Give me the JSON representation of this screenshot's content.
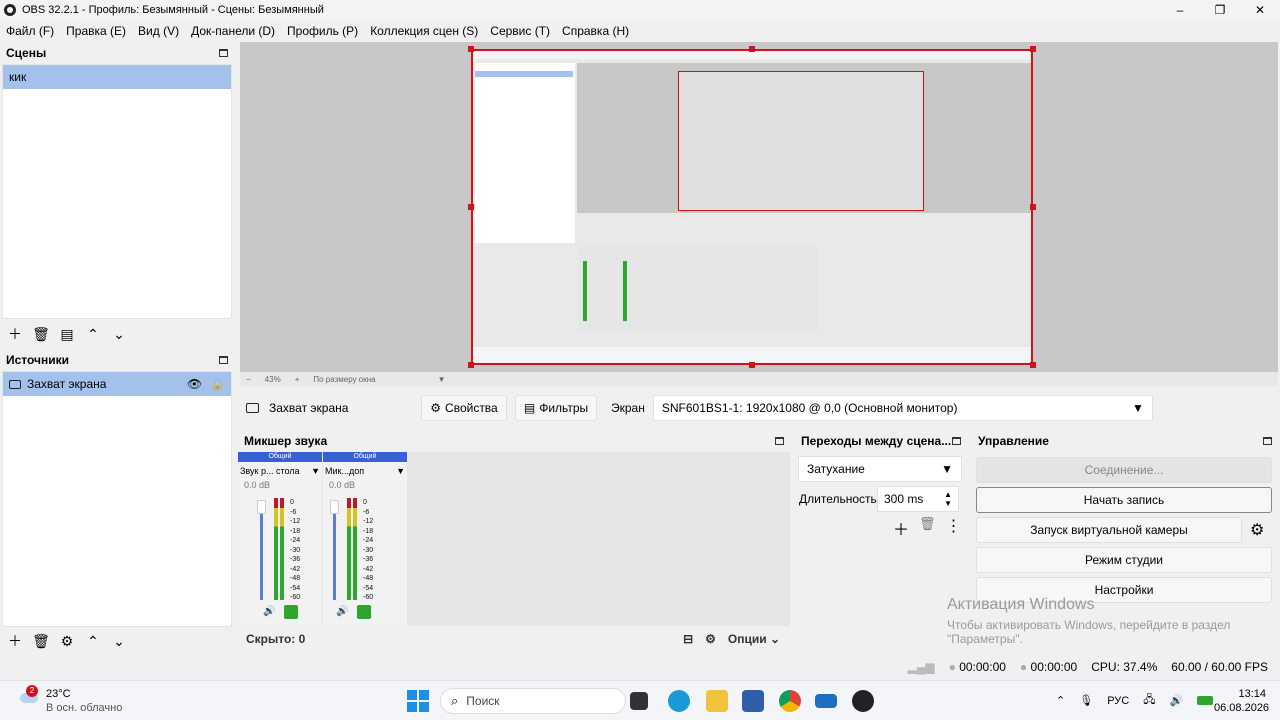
{
  "window": {
    "title": "OBS 32.2.1 - Профиль: Безымянный - Сцены: Безымянный",
    "minimize": "–",
    "maximize": "❐",
    "close": "✕"
  },
  "menu": [
    "Файл (F)",
    "Правка (E)",
    "Вид (V)",
    "Док-панели (D)",
    "Профиль (P)",
    "Коллекция сцен (S)",
    "Сервис (T)",
    "Справка (H)"
  ],
  "scenes": {
    "title": "Сцены",
    "items": [
      "кик"
    ]
  },
  "sources": {
    "title": "Источники",
    "items": [
      "Захват экрана"
    ]
  },
  "preview": {
    "zoom": "43%",
    "zoom_minus": "−",
    "zoom_plus": "+",
    "fit": "По размеру окна"
  },
  "source_bar": {
    "name": "Захват экрана",
    "properties": "Свойства",
    "filters": "Фильтры",
    "screen_label": "Экран",
    "screen_value": "SNF601BS1-1: 1920x1080 @ 0,0 (Основной монитор)"
  },
  "mixer": {
    "title": "Микшер звука",
    "channels": [
      {
        "tag": "Общий",
        "name": "Звук р... стола",
        "db": "0.0 dB"
      },
      {
        "tag": "Общий",
        "name": "Мик...доп",
        "db": "0.0 dB"
      }
    ],
    "ticks": [
      "0",
      "-6",
      "-12",
      "-18",
      "-24",
      "-30",
      "-36",
      "-42",
      "-48",
      "-54",
      "-60"
    ],
    "hidden": "Скрыто: 0",
    "options": "Опции"
  },
  "transitions": {
    "title": "Переходы между сцена...",
    "type": "Затухание",
    "duration_label": "Длительность",
    "duration": "300 ms"
  },
  "controls": {
    "title": "Управление",
    "connect": "Соединение...",
    "record": "Начать запись",
    "virtual_cam": "Запуск виртуальной камеры",
    "studio": "Режим студии",
    "settings": "Настройки"
  },
  "activation": {
    "title": "Активация Windows",
    "line1": "Чтобы активировать Windows, перейдите в раздел",
    "line2": "\"Параметры\"."
  },
  "status": {
    "rec_time": "00:00:00",
    "stream_time": "00:00:00",
    "cpu": "CPU: 37.4%",
    "fps": "60.00 / 60.00 FPS"
  },
  "taskbar": {
    "weather_badge": "2",
    "temp": "23°C",
    "weather": "В осн. облачно",
    "search": "Поиск",
    "lang": "РУС",
    "time": "13:14",
    "date": "06.08.2026"
  },
  "colors": {
    "accent_red": "#d0121a",
    "selection": "#a4c1ec",
    "mixer_header": "#3a5fd4",
    "meter_green": "#2ea52e"
  }
}
